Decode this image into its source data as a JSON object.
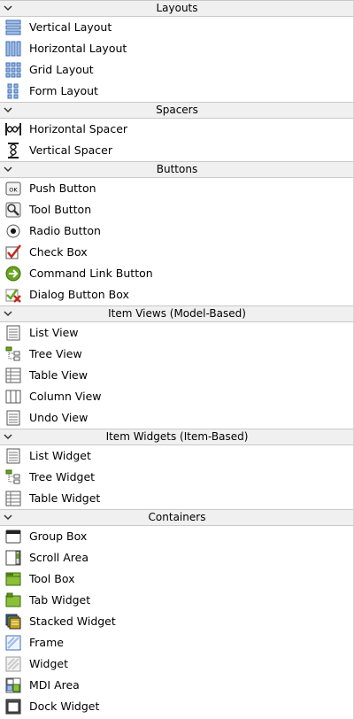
{
  "colors": {
    "header_bg": "#f0f0f0",
    "header_border": "#c9c9c9",
    "icon_blue": "#5b87c7",
    "icon_green": "#6aa51f",
    "icon_red": "#c4281b"
  },
  "categories": [
    {
      "title": "Layouts",
      "items": [
        {
          "label": "Vertical Layout",
          "icon": "vertical-layout-icon"
        },
        {
          "label": "Horizontal Layout",
          "icon": "horizontal-layout-icon"
        },
        {
          "label": "Grid Layout",
          "icon": "grid-layout-icon"
        },
        {
          "label": "Form Layout",
          "icon": "form-layout-icon"
        }
      ]
    },
    {
      "title": "Spacers",
      "items": [
        {
          "label": "Horizontal Spacer",
          "icon": "horizontal-spacer-icon"
        },
        {
          "label": "Vertical Spacer",
          "icon": "vertical-spacer-icon"
        }
      ]
    },
    {
      "title": "Buttons",
      "items": [
        {
          "label": "Push Button",
          "icon": "push-button-icon"
        },
        {
          "label": "Tool Button",
          "icon": "tool-button-icon"
        },
        {
          "label": "Radio Button",
          "icon": "radio-button-icon"
        },
        {
          "label": "Check Box",
          "icon": "check-box-icon"
        },
        {
          "label": "Command Link Button",
          "icon": "command-link-icon"
        },
        {
          "label": "Dialog Button Box",
          "icon": "dialog-button-box-icon"
        }
      ]
    },
    {
      "title": "Item Views (Model-Based)",
      "items": [
        {
          "label": "List View",
          "icon": "list-view-icon"
        },
        {
          "label": "Tree View",
          "icon": "tree-view-icon"
        },
        {
          "label": "Table View",
          "icon": "table-view-icon"
        },
        {
          "label": "Column View",
          "icon": "column-view-icon"
        },
        {
          "label": "Undo View",
          "icon": "undo-view-icon"
        }
      ]
    },
    {
      "title": "Item Widgets (Item-Based)",
      "items": [
        {
          "label": "List Widget",
          "icon": "list-widget-icon"
        },
        {
          "label": "Tree Widget",
          "icon": "tree-widget-icon"
        },
        {
          "label": "Table Widget",
          "icon": "table-widget-icon"
        }
      ]
    },
    {
      "title": "Containers",
      "items": [
        {
          "label": "Group Box",
          "icon": "group-box-icon"
        },
        {
          "label": "Scroll Area",
          "icon": "scroll-area-icon"
        },
        {
          "label": "Tool Box",
          "icon": "tool-box-icon"
        },
        {
          "label": "Tab Widget",
          "icon": "tab-widget-icon"
        },
        {
          "label": "Stacked Widget",
          "icon": "stacked-widget-icon"
        },
        {
          "label": "Frame",
          "icon": "frame-icon"
        },
        {
          "label": "Widget",
          "icon": "widget-icon"
        },
        {
          "label": "MDI Area",
          "icon": "mdi-area-icon"
        },
        {
          "label": "Dock Widget",
          "icon": "dock-widget-icon"
        }
      ]
    }
  ]
}
